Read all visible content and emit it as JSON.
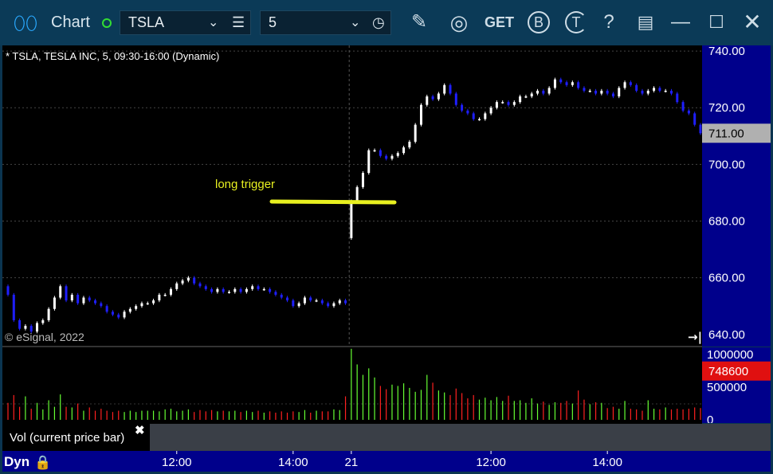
{
  "window": {
    "app_title": "Chart",
    "symbol": "TSLA",
    "interval": "5",
    "buttons": [
      "draw",
      "studies",
      "GET",
      "B",
      "T",
      "?",
      "layout",
      "minimize",
      "maximize",
      "close"
    ]
  },
  "chart_header": "* TSLA, TESLA INC, 5, 09:30-16:00 (Dynamic)",
  "watermark": "© eSignal, 2022",
  "annotation": "long trigger",
  "price_axis": {
    "ticks": [
      "740.00",
      "720.00",
      "700.00",
      "680.00",
      "660.00",
      "640.00"
    ],
    "current_price": "711.00"
  },
  "volume_axis": {
    "ticks": [
      "1000000",
      "500000",
      "0"
    ],
    "current_volume": "748600"
  },
  "volume_legend": "Vol (current price bar)",
  "time_axis": {
    "mode": "Dyn",
    "ticks": [
      "12:00",
      "14:00",
      "21",
      "12:00",
      "14:00"
    ]
  },
  "colors": {
    "up": "#ffffff",
    "down": "#1f1fff",
    "vol_up": "#66ff33",
    "vol_down": "#ff2020",
    "annotation": "#e8f020",
    "current_price_bg": "#b0b0b0",
    "current_vol_bg": "#e01010"
  },
  "chart_data": {
    "type": "candlestick",
    "title": "* TSLA, TESLA INC, 5, 09:30-16:00 (Dynamic)",
    "y_range": [
      636,
      742
    ],
    "volume_range": [
      0,
      1100000
    ],
    "day_break_index": 59,
    "candles": [
      [
        657,
        654
      ],
      [
        654,
        645
      ],
      [
        645,
        642
      ],
      [
        642,
        643
      ],
      [
        643,
        641
      ],
      [
        641,
        644
      ],
      [
        644,
        645
      ],
      [
        645,
        649
      ],
      [
        649,
        653
      ],
      [
        653,
        657
      ],
      [
        657,
        652
      ],
      [
        652,
        654
      ],
      [
        654,
        651
      ],
      [
        651,
        653
      ],
      [
        653,
        652
      ],
      [
        652,
        651
      ],
      [
        651,
        650
      ],
      [
        650,
        648
      ],
      [
        648,
        647
      ],
      [
        647,
        646
      ],
      [
        646,
        648
      ],
      [
        648,
        649
      ],
      [
        649,
        650
      ],
      [
        650,
        651
      ],
      [
        651,
        651
      ],
      [
        651,
        652
      ],
      [
        652,
        654
      ],
      [
        654,
        654
      ],
      [
        654,
        656
      ],
      [
        656,
        658
      ],
      [
        658,
        659
      ],
      [
        659,
        660
      ],
      [
        660,
        658
      ],
      [
        658,
        657
      ],
      [
        657,
        656
      ],
      [
        656,
        655
      ],
      [
        655,
        656
      ],
      [
        656,
        655
      ],
      [
        655,
        655
      ],
      [
        655,
        656
      ],
      [
        656,
        655
      ],
      [
        655,
        656
      ],
      [
        656,
        657
      ],
      [
        657,
        656
      ],
      [
        656,
        656
      ],
      [
        656,
        655
      ],
      [
        655,
        654
      ],
      [
        654,
        653
      ],
      [
        653,
        652
      ],
      [
        652,
        650
      ],
      [
        650,
        651
      ],
      [
        651,
        653
      ],
      [
        653,
        652
      ],
      [
        652,
        652
      ],
      [
        652,
        651
      ],
      [
        651,
        650
      ],
      [
        650,
        651
      ],
      [
        651,
        652
      ],
      [
        652,
        651
      ],
      [
        674,
        687
      ],
      [
        687,
        692
      ],
      [
        692,
        697
      ],
      [
        697,
        705
      ],
      [
        705,
        705
      ],
      [
        705,
        703
      ],
      [
        703,
        702
      ],
      [
        702,
        703
      ],
      [
        703,
        704
      ],
      [
        704,
        706
      ],
      [
        706,
        708
      ],
      [
        708,
        714
      ],
      [
        714,
        721
      ],
      [
        721,
        724
      ],
      [
        724,
        723
      ],
      [
        723,
        725
      ],
      [
        725,
        728
      ],
      [
        728,
        725
      ],
      [
        725,
        721
      ],
      [
        721,
        719
      ],
      [
        719,
        718
      ],
      [
        718,
        716
      ],
      [
        716,
        716
      ],
      [
        716,
        718
      ],
      [
        718,
        720
      ],
      [
        720,
        722
      ],
      [
        722,
        722
      ],
      [
        722,
        721
      ],
      [
        721,
        722
      ],
      [
        722,
        724
      ],
      [
        724,
        724
      ],
      [
        724,
        725
      ],
      [
        725,
        726
      ],
      [
        726,
        725
      ],
      [
        725,
        727
      ],
      [
        727,
        730
      ],
      [
        730,
        729
      ],
      [
        729,
        728
      ],
      [
        728,
        729
      ],
      [
        729,
        727
      ],
      [
        727,
        726
      ],
      [
        726,
        726
      ],
      [
        726,
        725
      ],
      [
        725,
        726
      ],
      [
        726,
        725
      ],
      [
        725,
        724
      ],
      [
        724,
        727
      ],
      [
        727,
        729
      ],
      [
        729,
        728
      ],
      [
        728,
        726
      ],
      [
        726,
        725
      ],
      [
        725,
        726
      ],
      [
        726,
        727
      ],
      [
        727,
        726
      ],
      [
        726,
        726
      ],
      [
        726,
        725
      ],
      [
        725,
        722
      ],
      [
        722,
        719
      ],
      [
        719,
        718
      ],
      [
        718,
        714
      ],
      [
        714,
        711
      ]
    ],
    "volume": [
      260000,
      380000,
      200000,
      360000,
      170000,
      260000,
      160000,
      300000,
      200000,
      390000,
      200000,
      190000,
      250000,
      140000,
      190000,
      140000,
      170000,
      140000,
      120000,
      140000,
      120000,
      140000,
      120000,
      140000,
      140000,
      140000,
      130000,
      160000,
      170000,
      130000,
      140000,
      160000,
      120000,
      150000,
      130000,
      150000,
      130000,
      140000,
      130000,
      140000,
      120000,
      140000,
      120000,
      140000,
      110000,
      130000,
      110000,
      130000,
      110000,
      130000,
      120000,
      150000,
      110000,
      140000,
      130000,
      130000,
      160000,
      150000,
      360000,
      1090000,
      850000,
      690000,
      790000,
      650000,
      520000,
      470000,
      540000,
      520000,
      560000,
      490000,
      430000,
      460000,
      690000,
      570000,
      450000,
      420000,
      380000,
      480000,
      410000,
      330000,
      380000,
      310000,
      340000,
      300000,
      350000,
      290000,
      370000,
      290000,
      300000,
      260000,
      330000,
      250000,
      280000,
      230000,
      270000,
      260000,
      290000,
      250000,
      450000,
      310000,
      240000,
      270000,
      260000,
      180000,
      200000,
      170000,
      290000,
      170000,
      160000,
      140000,
      300000,
      170000,
      160000,
      190000,
      160000,
      170000,
      160000,
      170000,
      190000,
      180000,
      190000,
      240000,
      300000,
      260000,
      370000,
      748600
    ]
  }
}
